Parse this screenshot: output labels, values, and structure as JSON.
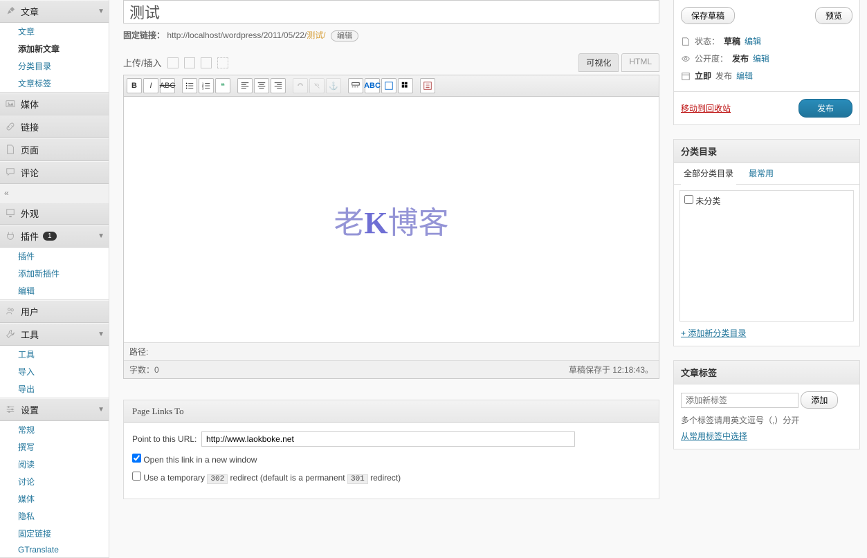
{
  "sidebar": {
    "posts": {
      "label": "文章",
      "items": [
        "文章",
        "添加新文章",
        "分类目录",
        "文章标签"
      ]
    },
    "media": {
      "label": "媒体"
    },
    "links": {
      "label": "链接"
    },
    "pages": {
      "label": "页面"
    },
    "comments": {
      "label": "评论"
    },
    "appearance": {
      "label": "外观"
    },
    "plugins": {
      "label": "插件",
      "badge": "1",
      "items": [
        "插件",
        "添加新插件",
        "编辑"
      ]
    },
    "users": {
      "label": "用户"
    },
    "tools": {
      "label": "工具",
      "items": [
        "工具",
        "导入",
        "导出"
      ]
    },
    "settings": {
      "label": "设置",
      "items": [
        "常规",
        "撰写",
        "阅读",
        "讨论",
        "媒体",
        "隐私",
        "固定链接",
        "GTranslate"
      ]
    }
  },
  "editor": {
    "title": "测试",
    "permalink": {
      "label": "固定链接：",
      "url": "http://localhost/wordpress/2011/05/22/",
      "slug": "测试/",
      "edit": "编辑"
    },
    "upload_label": "上传/插入",
    "tabs": {
      "visual": "可视化",
      "html": "HTML"
    },
    "watermark_pre": "老",
    "watermark_k": "K",
    "watermark_post": "博客",
    "path_label": "路径:",
    "wordcount": "字数：0",
    "autosave": "草稿保存于 12:18:43。"
  },
  "linksTo": {
    "title": "Page Links To",
    "point_label": "Point to this URL:",
    "url": "http://www.laokboke.net",
    "open_new": "Open this link in a new window",
    "temp_redirect_pre": "Use a temporary ",
    "temp_redirect_code1": "302",
    "temp_redirect_mid": " redirect (default is a permanent ",
    "temp_redirect_code2": "301",
    "temp_redirect_post": " redirect)"
  },
  "publish": {
    "save_draft": "保存草稿",
    "preview": "预览",
    "status_label": "状态：",
    "status_value": "草稿",
    "status_edit": "编辑",
    "visibility_label": "公开度：",
    "visibility_value": "发布",
    "visibility_edit": "编辑",
    "schedule_label": "立即",
    "schedule_value": "发布",
    "schedule_edit": "编辑",
    "trash": "移动到回收站",
    "publish_btn": "发布"
  },
  "categories": {
    "title": "分类目录",
    "tab_all": "全部分类目录",
    "tab_pop": "最常用",
    "item1": "未分类",
    "add_new": "+ 添加新分类目录"
  },
  "tags": {
    "title": "文章标签",
    "placeholder": "添加新标签",
    "add_btn": "添加",
    "hint": "多个标签请用英文逗号（,）分开",
    "choose": "从常用标签中选择"
  }
}
